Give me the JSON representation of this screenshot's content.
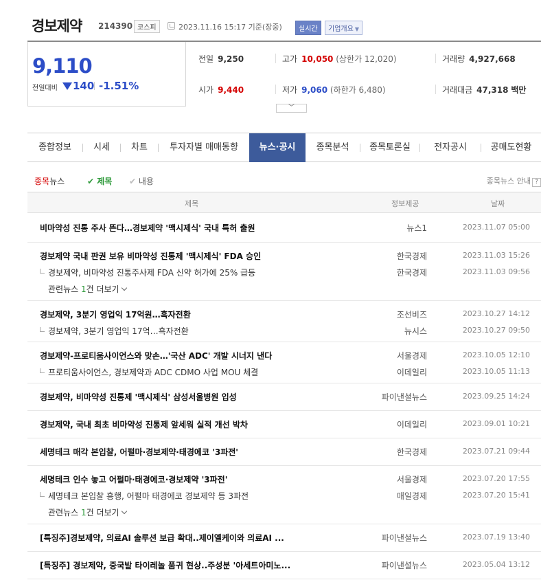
{
  "header": {
    "company_name": "경보제약",
    "stock_code": "214390",
    "market": "코스피",
    "datetime": "2023.11.16 15:17 기준(장중)",
    "realtime_label": "실시간",
    "overview_label": "기업개요"
  },
  "price": {
    "current": "9,110",
    "change_label": "전일대비",
    "change": "140",
    "change_rate": "-1.51%",
    "direction": "down"
  },
  "stats": {
    "prev_close": {
      "label": "전일",
      "value": "9,250"
    },
    "high": {
      "label": "고가",
      "value": "10,050",
      "sub": "(상한가 12,020)"
    },
    "volume": {
      "label": "거래량",
      "value": "4,927,668"
    },
    "open": {
      "label": "시가",
      "value": "9,440"
    },
    "low": {
      "label": "저가",
      "value": "9,060",
      "sub": "(하한가 6,480)"
    },
    "amount": {
      "label": "거래대금",
      "value": "47,318",
      "unit": "백만"
    }
  },
  "tabs": [
    "종합정보",
    "시세",
    "차트",
    "투자자별 매매동향",
    "뉴스·공시",
    "종목분석",
    "종목토론실",
    "전자공시",
    "공매도현황"
  ],
  "filter": {
    "source_prefix": "종목",
    "source_suffix": "뉴스",
    "title_option": "제목",
    "body_option": "내용",
    "guide": "종목뉴스 안내",
    "guide_icon": "?"
  },
  "columns": {
    "title": "제목",
    "source": "정보제공",
    "date": "날짜"
  },
  "news": [
    {
      "title": "비마약성 진통 주사 뜬다…경보제약 '맥시제식' 국내 특허 출원",
      "source": "뉴스1",
      "date": "2023.11.07 05:00",
      "related": []
    },
    {
      "title": "경보제약 국내 판권 보유 비마약성 진통제 '맥시제식' FDA 승인",
      "source": "한국경제",
      "date": "2023.11.03 15:26",
      "related": [
        {
          "title": "경보제약, 비마약성 진통주사제 FDA 신약 허가에 25% 급등",
          "source": "한국경제",
          "date": "2023.11.03 09:56"
        }
      ],
      "more": {
        "prefix": "관련뉴스 ",
        "count": "1",
        "suffix": "건 더보기"
      }
    },
    {
      "title": "경보제약, 3분기 영업익 17억원…흑자전환",
      "source": "조선비즈",
      "date": "2023.10.27 14:12",
      "related": [
        {
          "title": "경보제약, 3분기 영업익 17억…흑자전환",
          "source": "뉴시스",
          "date": "2023.10.27 09:50"
        }
      ]
    },
    {
      "title": "경보제약-프로티움사이언스와 맞손…'국산 ADC' 개발 시너지 낸다",
      "source": "서울경제",
      "date": "2023.10.05 12:10",
      "related": [
        {
          "title": "프로티움사이언스, 경보제약과 ADC CDMO 사업 MOU 체결",
          "source": "이데일리",
          "date": "2023.10.05 11:13"
        }
      ]
    },
    {
      "title": "경보제약, 비마약성 진통제 '맥시제식' 삼성서울병원 입성",
      "source": "파이낸셜뉴스",
      "date": "2023.09.25 14:24",
      "related": []
    },
    {
      "title": "경보제약, 국내 최초 비마약성 진통제 앞세워 실적 개선 박차",
      "source": "이데일리",
      "date": "2023.09.01 10:21",
      "related": []
    },
    {
      "title": "세명테크 매각 본입찰, 어펄마·경보제약·태경에코 '3파전'",
      "source": "한국경제",
      "date": "2023.07.21 09:44",
      "related": []
    },
    {
      "title": "세명테크 인수 놓고 어펄마·태경에코·경보제약 '3파전'",
      "source": "서울경제",
      "date": "2023.07.20 17:55",
      "related": [
        {
          "title": "세명테크 본입찰 흥행, 어펄마 태경에코 경보제약 등 3파전",
          "source": "매일경제",
          "date": "2023.07.20 15:41"
        }
      ],
      "more": {
        "prefix": "관련뉴스 ",
        "count": "1",
        "suffix": "건 더보기"
      }
    },
    {
      "title": "[특징주]경보제약, 의료AI 솔루션 보급 확대..제이엘케이와 의료AI ...",
      "source": "파이낸셜뉴스",
      "date": "2023.07.19 13:40",
      "related": []
    },
    {
      "title": "[특징주] 경보제약, 중국발 타이레놀 품귀 현상..주성분 '아세트아미노...",
      "source": "파이낸셜뉴스",
      "date": "2023.05.04 13:12",
      "related": []
    }
  ],
  "colors": {
    "accent": "#3d5b9b",
    "down": "#2c4dc7",
    "up": "#d40000",
    "green": "#2e9a3a"
  }
}
